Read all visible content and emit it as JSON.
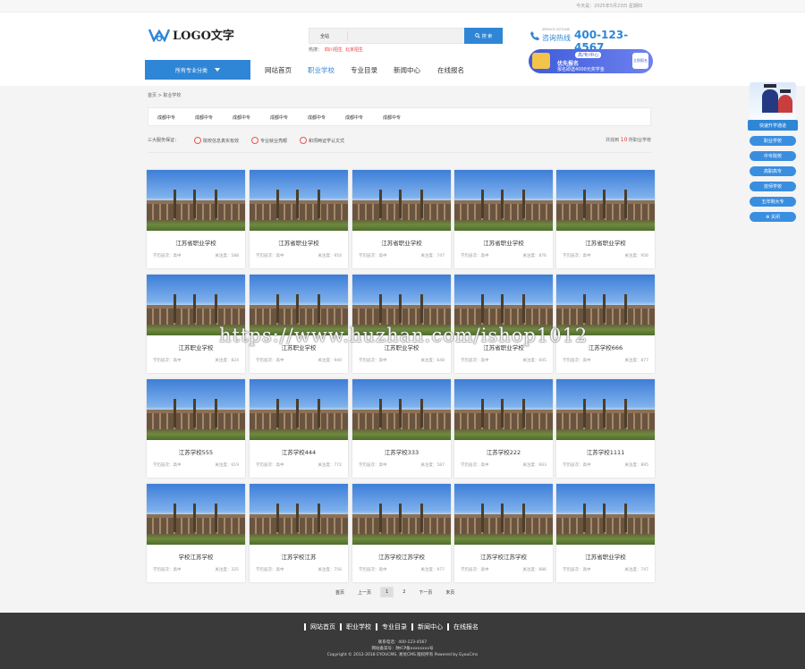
{
  "topbar": {
    "date": "今天是：2025年5月23日 星期四"
  },
  "header": {
    "logo_text": "LOGO文字",
    "search_select": "全站",
    "search_button": "搜 索",
    "hot_label": "热搜：",
    "hot_words": [
      "四川招生",
      "北京招生"
    ],
    "hotline_en": "SERVICE HOTLINE",
    "hotline_cn": "咨询热线",
    "hotline_number": "400-123-4567",
    "banner_tag": "高/专/中心",
    "banner_title": "优先报名",
    "banner_sub": "报名即送4000元奖学金",
    "banner_go": "立即报名"
  },
  "nav": {
    "all_categories": "所有专业分类",
    "items": [
      "网站首页",
      "职业学校",
      "专业目录",
      "新闻中心",
      "在线报名"
    ],
    "active_index": 1
  },
  "breadcrumb": "首页 > 职业学校",
  "categories": [
    "成都中专",
    "成都中专",
    "成都中专",
    "成都中专",
    "成都中专",
    "成都中专",
    "成都中专"
  ],
  "promise": {
    "label": "三大服务保证：",
    "items": [
      "院校信息真实有效",
      "专业就业亮眼",
      "和项两证学认文式"
    ],
    "total_prefix": "共找到",
    "total_count": "10",
    "total_suffix": "所职业学校"
  },
  "schools": [
    {
      "name": "江苏省职业学校",
      "level_label": "学历层次：",
      "level": "高中",
      "views_label": "关注度：",
      "views": "588"
    },
    {
      "name": "江苏省职业学校",
      "level_label": "学历层次：",
      "level": "高中",
      "views_label": "关注度：",
      "views": "954"
    },
    {
      "name": "江苏省职业学校",
      "level_label": "学历层次：",
      "level": "高中",
      "views_label": "关注度：",
      "views": "747"
    },
    {
      "name": "江苏省职业学校",
      "level_label": "学历层次：",
      "level": "高中",
      "views_label": "关注度：",
      "views": "876"
    },
    {
      "name": "江苏省职业学校",
      "level_label": "学历层次：",
      "level": "高中",
      "views_label": "关注度：",
      "views": "956"
    },
    {
      "name": "江苏职业学校",
      "level_label": "学历层次：",
      "level": "高中",
      "views_label": "关注度：",
      "views": "824"
    },
    {
      "name": "江苏职业学校",
      "level_label": "学历层次：",
      "level": "高中",
      "views_label": "关注度：",
      "views": "940"
    },
    {
      "name": "江苏职业学校",
      "level_label": "学历层次：",
      "level": "高中",
      "views_label": "关注度：",
      "views": "648"
    },
    {
      "name": "江苏省职业学校",
      "level_label": "学历层次：",
      "level": "高中",
      "views_label": "关注度：",
      "views": "605"
    },
    {
      "name": "江苏学校666",
      "level_label": "学历层次：",
      "level": "高中",
      "views_label": "关注度：",
      "views": "877"
    },
    {
      "name": "江苏学校555",
      "level_label": "学历层次：",
      "level": "高中",
      "views_label": "关注度：",
      "views": "619"
    },
    {
      "name": "江苏学校444",
      "level_label": "学历层次：",
      "level": "高中",
      "views_label": "关注度：",
      "views": "772"
    },
    {
      "name": "江苏学校333",
      "level_label": "学历层次：",
      "level": "高中",
      "views_label": "关注度：",
      "views": "587"
    },
    {
      "name": "江苏学校222",
      "level_label": "学历层次：",
      "level": "高中",
      "views_label": "关注度：",
      "views": "663"
    },
    {
      "name": "江苏学校1111",
      "level_label": "学历层次：",
      "level": "高中",
      "views_label": "关注度：",
      "views": "895"
    },
    {
      "name": "学校江苏学校",
      "level_label": "学历层次：",
      "level": "高中",
      "views_label": "关注度：",
      "views": "325"
    },
    {
      "name": "江苏学校江苏",
      "level_label": "学历层次：",
      "level": "高中",
      "views_label": "关注度：",
      "views": "756"
    },
    {
      "name": "江苏学校江苏学校",
      "level_label": "学历层次：",
      "level": "高中",
      "views_label": "关注度：",
      "views": "977"
    },
    {
      "name": "江苏学校江苏学校",
      "level_label": "学历层次：",
      "level": "高中",
      "views_label": "关注度：",
      "views": "886"
    },
    {
      "name": "江苏省职业学校",
      "level_label": "学历层次：",
      "level": "高中",
      "views_label": "关注度：",
      "views": "747"
    }
  ],
  "watermark": "https://www.huzhan.com/ishop1012",
  "pager": {
    "first": "首页",
    "prev": "上一页",
    "pages": [
      "1",
      "2"
    ],
    "current": "1",
    "next": "下一页",
    "last": "末页"
  },
  "sidebar": {
    "fast_label": "快速升学通道",
    "items": [
      "职业学校",
      "中专院校",
      "高职高专",
      "技师学校",
      "五年制大专",
      "关闭"
    ]
  },
  "footer": {
    "links": [
      "网站首页",
      "职业学校",
      "专业目录",
      "新闻中心",
      "在线报名"
    ],
    "contact": "联系电话：400-123-4567",
    "icp": "网站备案号：陕ICP备xxxxxxxx号",
    "copyright": "Copyright © 2012-2018 EYOUCMS. 易优CMS 版权所有 Powered by EyouCms"
  },
  "colors": {
    "accent": "#2f86d6",
    "highlight": "#ee3333",
    "footer_bg": "#3a3a3a"
  }
}
